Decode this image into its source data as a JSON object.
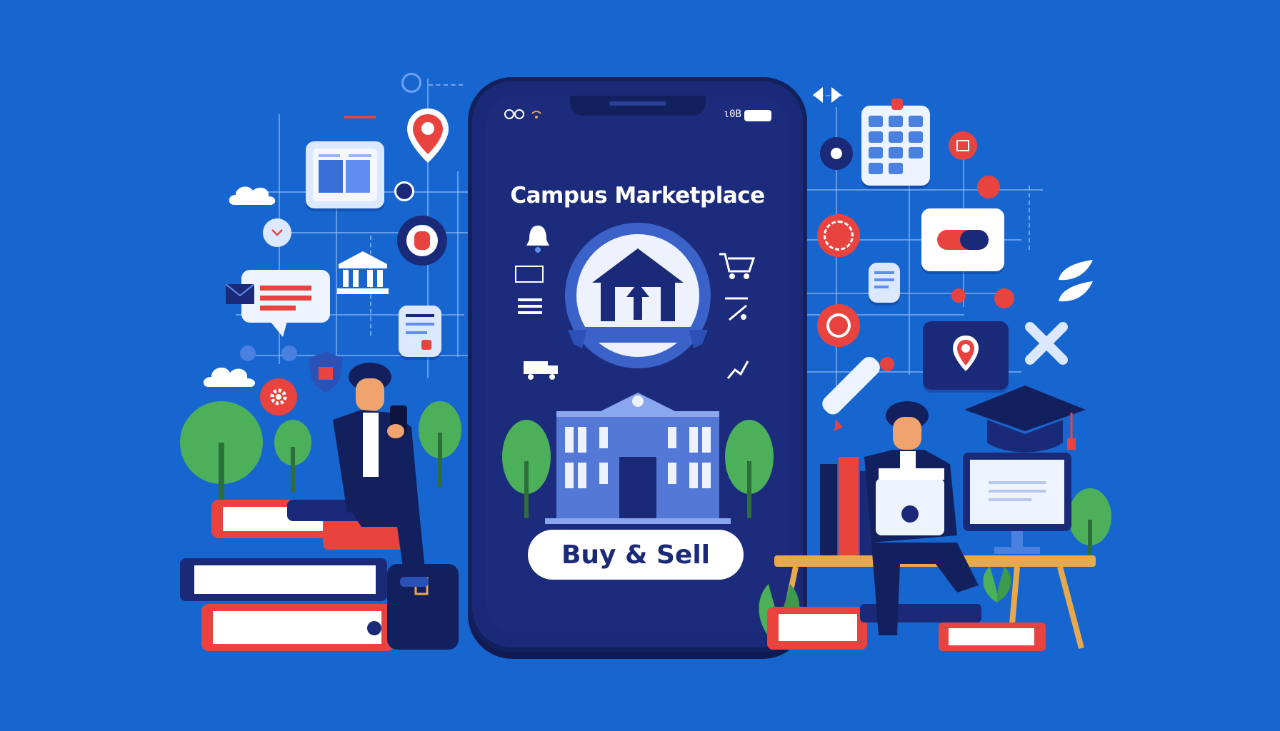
{
  "app": {
    "title": "Campus Marketplace",
    "cta_label": "Buy & Sell"
  },
  "status_bar": {
    "left_icons": "eyeglasses-icon",
    "right_text": "ι0B"
  },
  "colors": {
    "background": "#1766cf",
    "phone": "#1b2a78",
    "accent_red": "#e8433f",
    "white": "#ffffff",
    "tree_green": "#4caf5a"
  },
  "icons": [
    "location-pin-icon",
    "book-icon",
    "cloud-icon",
    "chat-bubble-icon",
    "bank-building-icon",
    "gear-icon",
    "calendar-icon",
    "toggle-icon",
    "map-pin-icon",
    "graduation-cap-icon",
    "laptop-icon",
    "monitor-icon",
    "diploma-scroll-icon",
    "shopping-cart-icon",
    "home-upload-icon",
    "university-building-icon"
  ]
}
